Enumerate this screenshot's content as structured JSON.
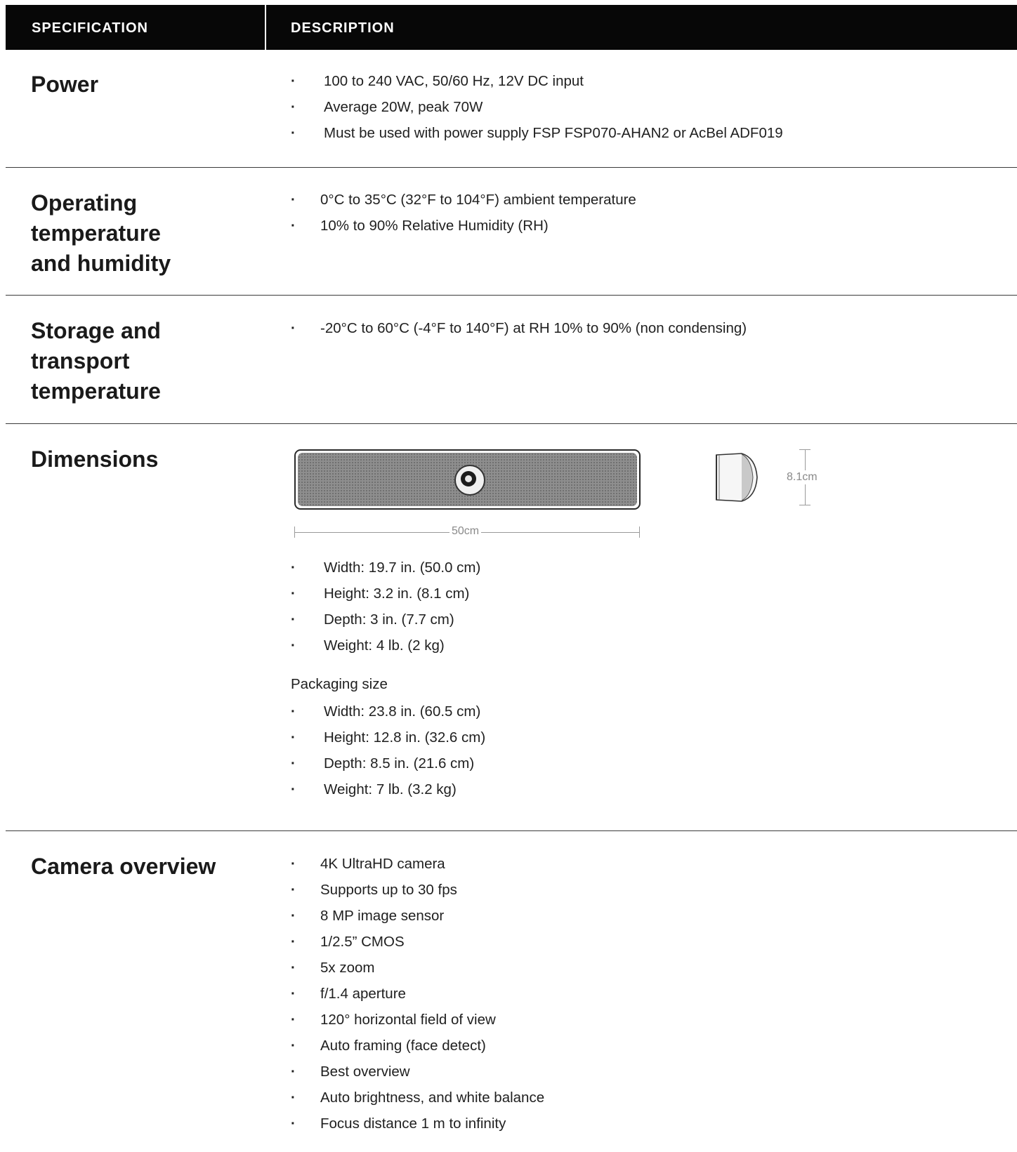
{
  "header": {
    "col_spec": "SPECIFICATION",
    "col_desc": "DESCRIPTION"
  },
  "rows": {
    "power": {
      "label": "Power",
      "items": [
        "100 to 240 VAC, 50/60 Hz, 12V DC input",
        "Average 20W, peak 70W",
        "Must be used with power supply FSP FSP070-AHAN2 or AcBel ADF019"
      ]
    },
    "operating": {
      "label_lines": [
        "Operating",
        "temperature",
        "and humidity"
      ],
      "items": [
        "0°C to 35°C (32°F to 104°F) ambient temperature",
        "10% to 90% Relative Humidity (RH)"
      ]
    },
    "storage": {
      "label_lines": [
        "Storage and",
        "transport",
        "temperature"
      ],
      "items": [
        "-20°C to 60°C (-4°F to 140°F) at RH 10% to 90% (non condensing)"
      ]
    },
    "dimensions": {
      "label": "Dimensions",
      "width_label": "50cm",
      "height_label": "8.1cm",
      "items": [
        "Width: 19.7 in. (50.0 cm)",
        "Height: 3.2 in. (8.1 cm)",
        "Depth: 3 in. (7.7 cm)",
        "Weight: 4 lb. (2 kg)"
      ],
      "packaging_title": "Packaging size",
      "packaging_items": [
        "Width: 23.8 in. (60.5 cm)",
        "Height: 12.8 in. (32.6 cm)",
        "Depth: 8.5 in. (21.6 cm)",
        "Weight: 7 lb. (3.2 kg)"
      ]
    },
    "camera": {
      "label": "Camera overview",
      "items": [
        "4K UltraHD camera",
        "Supports up to 30 fps",
        "8 MP image sensor",
        "1/2.5” CMOS",
        "5x zoom",
        "f/1.4 aperture",
        "120° horizontal field of view",
        "Auto framing (face detect)",
        "Best overview",
        "Auto brightness, and white balance",
        "Focus distance 1 m to infinity"
      ]
    }
  },
  "bullet": "·"
}
